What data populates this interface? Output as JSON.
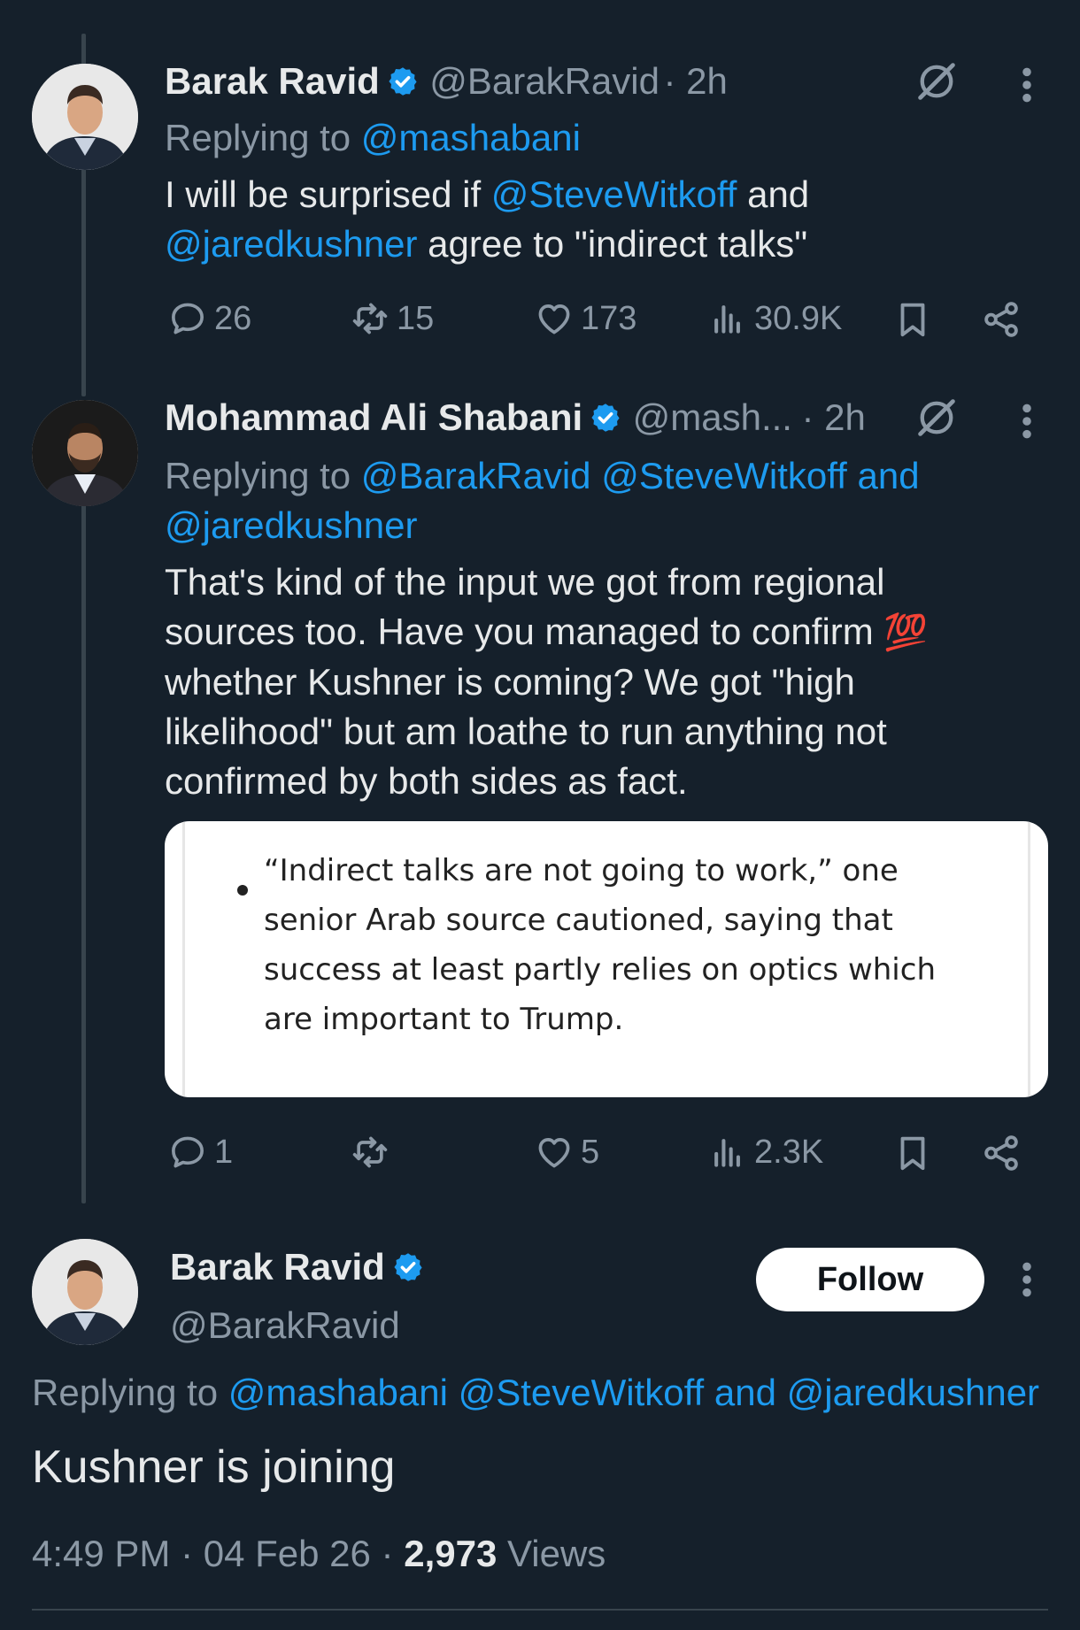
{
  "tweet1": {
    "name": "Barak Ravid",
    "handle": "@BarakRavid",
    "time": "· 2h",
    "replying_label": "Replying to",
    "replying_to": "@mashabani",
    "body_1": "I will be surprised if",
    "mention_1": "@SteveWitkoff",
    "body_2": "and",
    "mention_2": "@jaredkushner",
    "body_3": "agree to \"indirect talks\"",
    "stats": {
      "replies": "26",
      "reposts": "15",
      "likes": "173",
      "views": "30.9K"
    }
  },
  "tweet2": {
    "name": "Mohammad Ali Shabani",
    "handle": "@mash...",
    "time": "· 2h",
    "replying_label": "Replying to",
    "replying_to_1": "@BarakRavid @SteveWitkoff and",
    "replying_to_2": "@jaredkushner",
    "body_line1": "That's kind of the input we got from regional",
    "body_line2": "sources too. Have you managed to confirm",
    "emoji": "💯",
    "body_line3": "whether Kushner is coming? We got \"high",
    "body_line4": "likelihood\" but am loathe to run anything not",
    "body_line5": "confirmed by both sides as fact.",
    "quote": {
      "line1": "“Indirect talks are not going to work,” one",
      "line2": "senior Arab source cautioned, saying that",
      "line3": "success at least partly relies on optics which",
      "line4": "are important to Trump."
    },
    "stats": {
      "replies": "1",
      "reposts": "",
      "likes": "5",
      "views": "2.3K"
    }
  },
  "main_tweet": {
    "name": "Barak Ravid",
    "handle": "@BarakRavid",
    "follow_label": "Follow",
    "replying_label": "Replying to",
    "replying_to": "@mashabani @SteveWitkoff and @jaredkushner",
    "body": "Kushner is joining",
    "time": "4:49 PM · 04 Feb 26 ·",
    "views_count": "2,973",
    "views_label": "Views"
  },
  "colors": {
    "background": "#15202b",
    "accent": "#1d9bf0",
    "muted": "#8b98a5",
    "text": "#e7e9ea",
    "emoji_red": "#e0313a"
  },
  "icons": [
    "verified-badge-icon",
    "grok-icon",
    "more-icon",
    "reply-icon",
    "repost-icon",
    "like-icon",
    "views-icon",
    "bookmark-icon",
    "share-icon"
  ]
}
